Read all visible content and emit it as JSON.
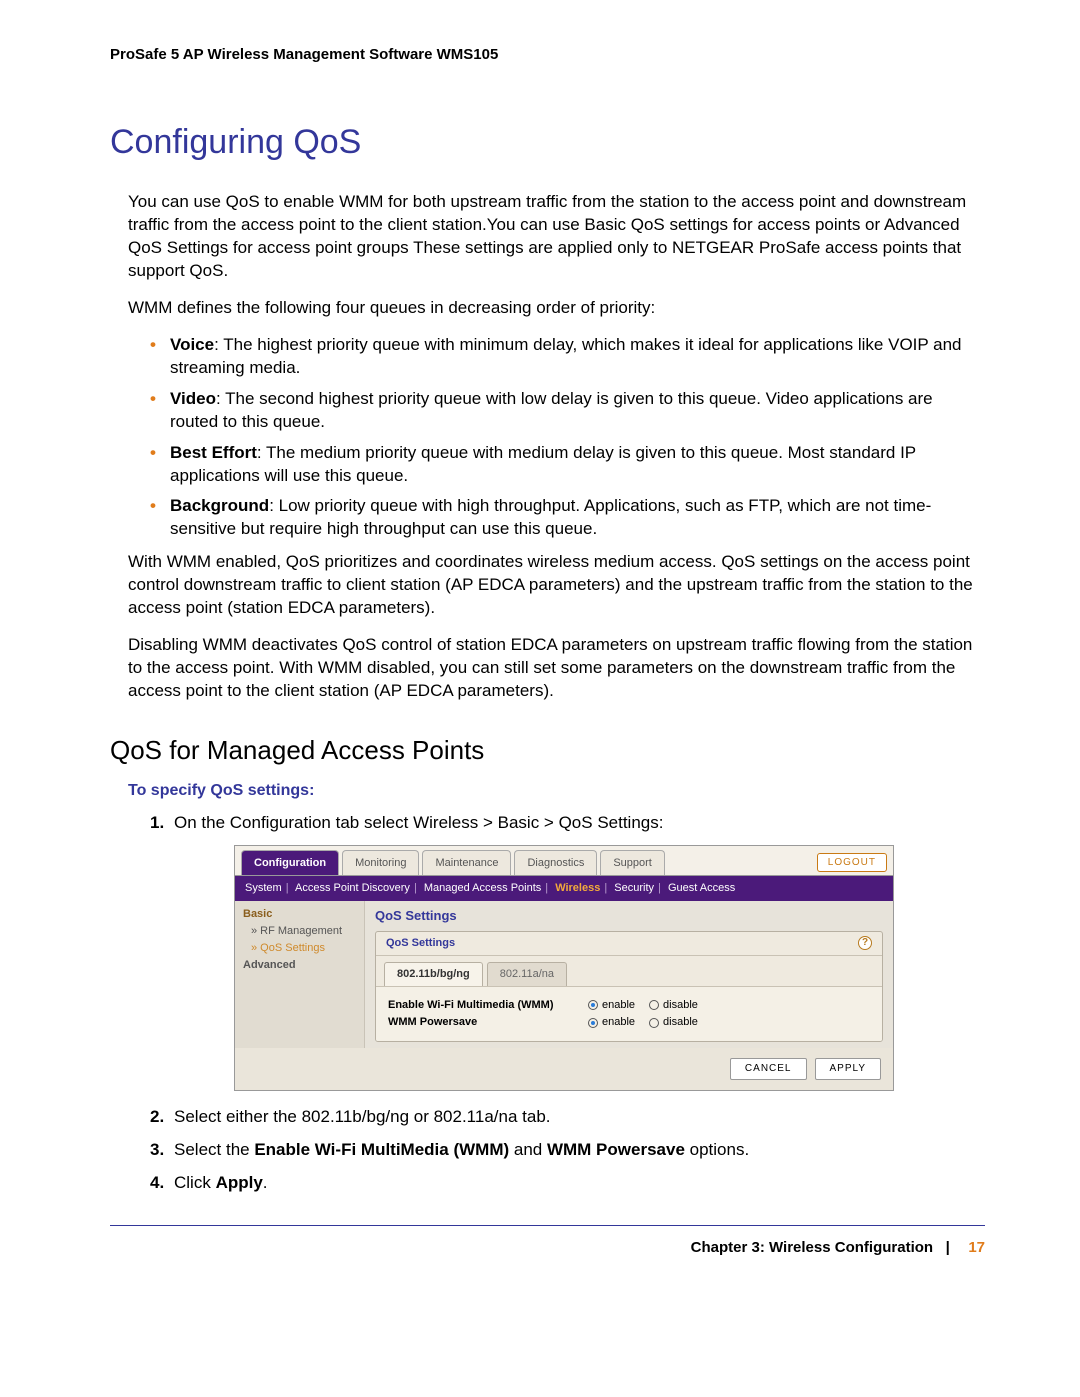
{
  "doc_title": "ProSafe 5 AP Wireless Management Software WMS105",
  "h1": "Configuring QoS",
  "intro": "You can use QoS to enable WMM for both upstream traffic from the station to the access point and downstream traffic from the access point to the client station.You can use Basic QoS settings for access points or Advanced QoS Settings for access point groups These settings are applied only to NETGEAR ProSafe access points that support QoS.",
  "wmm_lead": "WMM defines the following four queues in decreasing order of priority:",
  "queues": [
    {
      "label": "Voice",
      "text": ": The highest priority queue with minimum delay, which makes it ideal for applications like VOIP and streaming media."
    },
    {
      "label": "Video",
      "text": ": The second highest priority queue with low delay is given to this queue. Video applications are routed to this queue."
    },
    {
      "label": "Best Effort",
      "text": ": The medium priority queue with medium delay is given to this queue. Most standard IP applications will use this queue."
    },
    {
      "label": "Background",
      "text": ": Low priority queue with high throughput. Applications, such as FTP, which are not time-sensitive but require high throughput can use this queue."
    }
  ],
  "para_wmm_enabled": "With WMM enabled, QoS prioritizes and coordinates wireless medium access. QoS settings on the access point control downstream traffic to client station (AP EDCA parameters) and the upstream traffic from the station to the access point (station EDCA parameters).",
  "para_disabling": "Disabling WMM deactivates QoS control of station EDCA parameters on upstream traffic flowing from the station to the access point. With WMM disabled, you can still set some parameters on the downstream traffic from the access point to the client station (AP EDCA parameters).",
  "h2": "QoS for Managed Access Points",
  "task": "To specify QoS settings:",
  "steps": {
    "s1": "On the Configuration tab select Wireless > Basic > QoS Settings:",
    "s2": "Select either the 802.11b/bg/ng or 802.11a/na tab.",
    "s3_prefix": "Select the ",
    "s3_b1": "Enable Wi-Fi MultiMedia (WMM)",
    "s3_mid": " and ",
    "s3_b2": "WMM Powersave",
    "s3_suffix": " options.",
    "s4_prefix": "Click ",
    "s4_b": "Apply",
    "s4_suffix": "."
  },
  "ui": {
    "tabs": [
      "Configuration",
      "Monitoring",
      "Maintenance",
      "Diagnostics",
      "Support"
    ],
    "logout": "LOGOUT",
    "subtabs": [
      "System",
      "Access Point Discovery",
      "Managed Access Points",
      "Wireless",
      "Security",
      "Guest Access"
    ],
    "side": {
      "basic": "Basic",
      "rf": "» RF Management",
      "qos": "» QoS Settings",
      "advanced": "Advanced"
    },
    "panel_title_outer": "QoS Settings",
    "panel_title_inner": "QoS Settings",
    "ptab1": "802.11b/bg/ng",
    "ptab2": "802.11a/na",
    "row1": "Enable Wi-Fi Multimedia (WMM)",
    "row2": "WMM Powersave",
    "enable": "enable",
    "disable": "disable",
    "cancel": "CANCEL",
    "apply": "APPLY",
    "help": "?"
  },
  "footer_chapter": "Chapter 3:  Wireless Configuration",
  "footer_sep": "|",
  "footer_page": "17"
}
